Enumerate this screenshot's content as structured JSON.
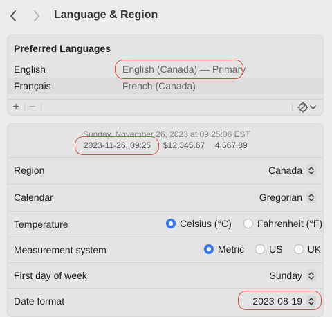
{
  "window": {
    "title": "Language & Region",
    "back_icon": "chevron-left-icon",
    "forward_icon": "chevron-right-icon"
  },
  "preferred_languages": {
    "header": "Preferred Languages",
    "items": [
      {
        "name": "English",
        "description": "English (Canada) — Primary"
      },
      {
        "name": "Français",
        "description": "French (Canada)"
      }
    ],
    "toolbar": {
      "add_label": "+",
      "remove_label": "−",
      "action_icon": "gear-icon"
    }
  },
  "preview": {
    "full_date": "Sunday, November 26, 2023 at 09:25:06 EST",
    "short_date": "2023-11-26, 09:25",
    "currency": "$12,345.67",
    "number": "4,567.89"
  },
  "settings": {
    "region": {
      "label": "Region",
      "value": "Canada"
    },
    "calendar": {
      "label": "Calendar",
      "value": "Gregorian"
    },
    "temperature": {
      "label": "Temperature",
      "options": [
        "Celsius (°C)",
        "Fahrenheit (°F)"
      ],
      "selected": "Celsius (°C)"
    },
    "measurement": {
      "label": "Measurement system",
      "options": [
        "Metric",
        "US",
        "UK"
      ],
      "selected": "Metric"
    },
    "first_day": {
      "label": "First day of week",
      "value": "Sunday"
    },
    "date_format": {
      "label": "Date format",
      "value": "2023-08-19"
    }
  },
  "colors": {
    "accent": "#3478f6",
    "annotation": "#e0463a",
    "background": "#ececec",
    "card": "#e4e4e4"
  }
}
